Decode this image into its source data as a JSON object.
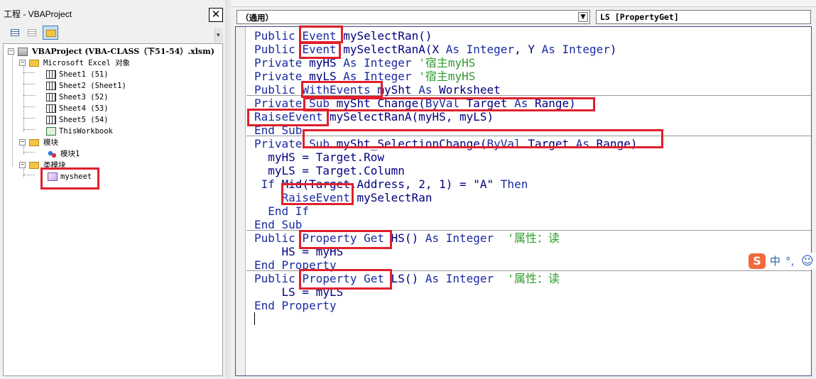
{
  "project_pane": {
    "title": "工程 - VBAProject",
    "close_glyph": "✕",
    "tree": {
      "root": "VBAProject (VBA-CLASS（下51-54）.xlsm)",
      "excel_objects_folder": "Microsoft Excel 对象",
      "sheets": [
        "Sheet1 (51)",
        "Sheet2 (Sheet1)",
        "Sheet3 (52)",
        "Sheet4 (53)",
        "Sheet5 (54)"
      ],
      "workbook": "ThisWorkbook",
      "modules_folder": "模块",
      "modules": [
        "模块1"
      ],
      "class_modules_folder": "类模块",
      "class_modules": [
        "mysheet"
      ]
    }
  },
  "code_window": {
    "object_combo": "（通用）",
    "procedure_combo": "LS [PropertyGet]",
    "lines": [
      [
        {
          "t": "Public ",
          "c": "kw"
        },
        {
          "t": "Event",
          "c": "kw"
        },
        {
          "t": " mySelectRan()",
          "c": "plain"
        }
      ],
      [
        {
          "t": "Public ",
          "c": "kw"
        },
        {
          "t": "Event",
          "c": "kw"
        },
        {
          "t": " mySelectRanA(X ",
          "c": "plain"
        },
        {
          "t": "As Integer",
          "c": "kw"
        },
        {
          "t": ", Y ",
          "c": "plain"
        },
        {
          "t": "As Integer",
          "c": "kw"
        },
        {
          "t": ")",
          "c": "plain"
        }
      ],
      [
        {
          "t": "Private ",
          "c": "kw"
        },
        {
          "t": "myHS ",
          "c": "plain"
        },
        {
          "t": "As Integer",
          "c": "kw"
        },
        {
          "t": " '宿主myHS",
          "c": "cm"
        }
      ],
      [
        {
          "t": "Private ",
          "c": "kw"
        },
        {
          "t": "myLS ",
          "c": "plain"
        },
        {
          "t": "As Integer",
          "c": "kw"
        },
        {
          "t": " '宿主myHS",
          "c": "cm"
        }
      ],
      [
        {
          "t": "Public ",
          "c": "kw"
        },
        {
          "t": "WithEvents",
          "c": "kw"
        },
        {
          "t": " mySht ",
          "c": "plain"
        },
        {
          "t": "As",
          "c": "kw"
        },
        {
          "t": " Worksheet",
          "c": "plain"
        }
      ],
      [
        {
          "t": "Private Sub",
          "c": "kw"
        },
        {
          "t": " mySht_Change(",
          "c": "plain"
        },
        {
          "t": "ByVal",
          "c": "kw"
        },
        {
          "t": " Target ",
          "c": "plain"
        },
        {
          "t": "As",
          "c": "kw"
        },
        {
          "t": " Range)",
          "c": "plain"
        }
      ],
      [
        {
          "t": "RaiseEvent",
          "c": "kw"
        },
        {
          "t": " mySelectRanA(myHS, myLS)",
          "c": "plain"
        }
      ],
      [
        {
          "t": "End Sub",
          "c": "kw"
        }
      ],
      [
        {
          "t": "Private Sub",
          "c": "kw"
        },
        {
          "t": " mySht_SelectionChange(",
          "c": "plain"
        },
        {
          "t": "ByVal",
          "c": "kw"
        },
        {
          "t": " Target ",
          "c": "plain"
        },
        {
          "t": "As",
          "c": "kw"
        },
        {
          "t": " Range)",
          "c": "plain"
        }
      ],
      [
        {
          "t": "  myHS = Target.Row",
          "c": "plain"
        }
      ],
      [
        {
          "t": "  myLS = Target.Column",
          "c": "plain"
        }
      ],
      [
        {
          "t": " If",
          "c": "kw"
        },
        {
          "t": " Mid(Target.Address, 2, 1) = \"A\" ",
          "c": "plain"
        },
        {
          "t": "Then",
          "c": "kw"
        }
      ],
      [
        {
          "t": "    RaiseEvent",
          "c": "kw"
        },
        {
          "t": " mySelectRan",
          "c": "plain"
        }
      ],
      [
        {
          "t": "  End If",
          "c": "kw"
        }
      ],
      [
        {
          "t": "End Sub",
          "c": "kw"
        }
      ],
      [
        {
          "t": "Public ",
          "c": "kw"
        },
        {
          "t": "Property Get",
          "c": "kw"
        },
        {
          "t": " HS() ",
          "c": "plain"
        },
        {
          "t": "As Integer",
          "c": "kw"
        },
        {
          "t": "  '属性：读",
          "c": "cm"
        }
      ],
      [
        {
          "t": "    HS = myHS",
          "c": "plain"
        }
      ],
      [
        {
          "t": "End Property",
          "c": "kw"
        }
      ],
      [
        {
          "t": "Public ",
          "c": "kw"
        },
        {
          "t": "Property Get",
          "c": "kw"
        },
        {
          "t": " LS() ",
          "c": "plain"
        },
        {
          "t": "As Integer",
          "c": "kw"
        },
        {
          "t": "  '属性：读",
          "c": "cm"
        }
      ],
      [
        {
          "t": "    LS = myLS",
          "c": "plain"
        }
      ],
      [
        {
          "t": "End Property",
          "c": "kw"
        }
      ]
    ]
  },
  "ime": {
    "logo": "S",
    "mode": "中",
    "punct": "°,",
    "emoji": "☺"
  },
  "colors": {
    "keyword": "#1a2aa0",
    "comment": "#2e9b2e",
    "identifier": "#000080",
    "highlight_box": "#e0202c"
  }
}
